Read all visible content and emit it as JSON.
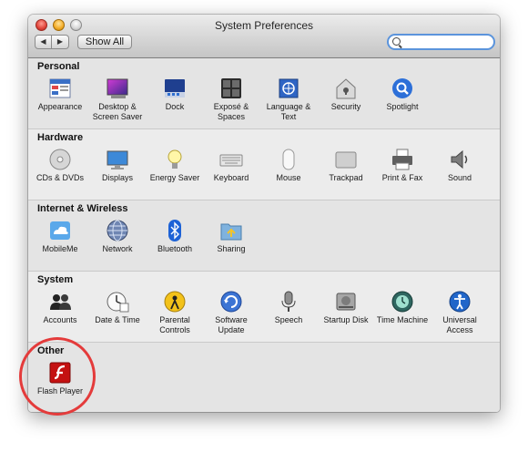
{
  "window": {
    "title": "System Preferences"
  },
  "toolbar": {
    "back": "◀",
    "forward": "▶",
    "show_all": "Show All",
    "search_placeholder": ""
  },
  "sections": [
    {
      "title": "Personal",
      "items": [
        {
          "label": "Appearance",
          "icon": "appearance-icon"
        },
        {
          "label": "Desktop & Screen Saver",
          "icon": "desktop-icon"
        },
        {
          "label": "Dock",
          "icon": "dock-icon"
        },
        {
          "label": "Exposé & Spaces",
          "icon": "expose-icon"
        },
        {
          "label": "Language & Text",
          "icon": "language-icon"
        },
        {
          "label": "Security",
          "icon": "security-icon"
        },
        {
          "label": "Spotlight",
          "icon": "spotlight-icon"
        }
      ]
    },
    {
      "title": "Hardware",
      "items": [
        {
          "label": "CDs & DVDs",
          "icon": "cd-icon"
        },
        {
          "label": "Displays",
          "icon": "display-icon"
        },
        {
          "label": "Energy Saver",
          "icon": "energy-icon"
        },
        {
          "label": "Keyboard",
          "icon": "keyboard-icon"
        },
        {
          "label": "Mouse",
          "icon": "mouse-icon"
        },
        {
          "label": "Trackpad",
          "icon": "trackpad-icon"
        },
        {
          "label": "Print & Fax",
          "icon": "printer-icon"
        },
        {
          "label": "Sound",
          "icon": "sound-icon"
        }
      ]
    },
    {
      "title": "Internet & Wireless",
      "items": [
        {
          "label": "MobileMe",
          "icon": "cloud-icon"
        },
        {
          "label": "Network",
          "icon": "network-icon"
        },
        {
          "label": "Bluetooth",
          "icon": "bluetooth-icon"
        },
        {
          "label": "Sharing",
          "icon": "sharing-icon"
        }
      ]
    },
    {
      "title": "System",
      "items": [
        {
          "label": "Accounts",
          "icon": "accounts-icon"
        },
        {
          "label": "Date & Time",
          "icon": "clock-icon"
        },
        {
          "label": "Parental Controls",
          "icon": "parental-icon"
        },
        {
          "label": "Software Update",
          "icon": "update-icon"
        },
        {
          "label": "Speech",
          "icon": "microphone-icon"
        },
        {
          "label": "Startup Disk",
          "icon": "disk-icon"
        },
        {
          "label": "Time Machine",
          "icon": "time-machine-icon"
        },
        {
          "label": "Universal Access",
          "icon": "accessibility-icon"
        }
      ]
    },
    {
      "title": "Other",
      "items": [
        {
          "label": "Flash Player",
          "icon": "flash-icon"
        }
      ]
    }
  ]
}
